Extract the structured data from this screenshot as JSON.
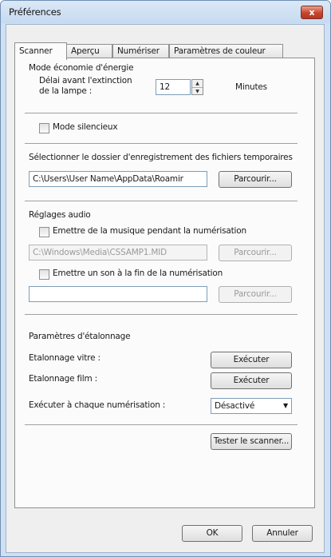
{
  "window": {
    "title": "Préférences",
    "close_glyph": "x"
  },
  "tabs": [
    "Scanner",
    "Aperçu",
    "Numériser",
    "Paramètres de couleur"
  ],
  "energy": {
    "heading": "Mode économie d'énergie",
    "delay_label_1": "Délai avant l'extinction",
    "delay_label_2": "de la lampe :",
    "delay_value": "12",
    "unit": "Minutes"
  },
  "silent_mode": {
    "label": "Mode silencieux",
    "checked": false
  },
  "temp_folder": {
    "heading": "Sélectionner le dossier d'enregistrement des fichiers temporaires",
    "path": "C:\\Users\\User Name\\AppData\\Roamir",
    "browse": "Parcourir..."
  },
  "audio": {
    "heading": "Réglages audio",
    "music_label": "Emettre de la musique pendant la numérisation",
    "music_path": "C:\\Windows\\Media\\CSSAMP1.MID",
    "music_browse": "Parcourir...",
    "end_sound_label": "Emettre un son à la fin de la numérisation",
    "end_sound_path": "",
    "end_sound_browse": "Parcourir..."
  },
  "calibration": {
    "heading": "Paramètres d'étalonnage",
    "glass_label": "Etalonnage vitre :",
    "glass_button": "Exécuter",
    "film_label": "Etalonnage film :",
    "film_button": "Exécuter",
    "each_scan_label": "Exécuter à chaque numérisation :",
    "each_scan_value": "Désactivé"
  },
  "test_button": "Tester le scanner...",
  "footer": {
    "ok": "OK",
    "cancel": "Annuler"
  }
}
